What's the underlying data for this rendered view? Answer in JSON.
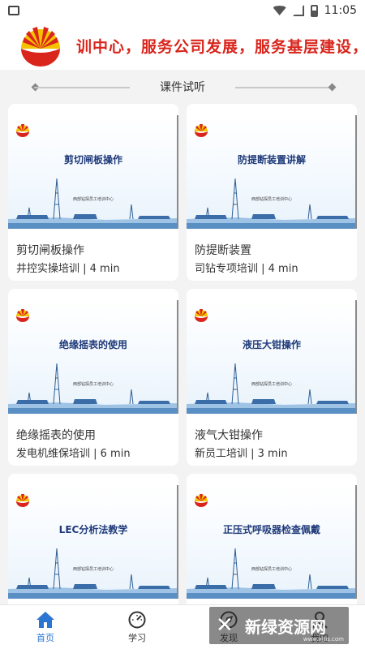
{
  "status_bar": {
    "time": "11:05"
  },
  "banner": {
    "marquee": "训中心，服务公司发展，服务基层建设，"
  },
  "section": {
    "title": "课件试听"
  },
  "courses": [
    {
      "thumb_title": "剪切闸板操作",
      "thumb_sub": "西部钻探员工培训中心",
      "name": "剪切闸板操作",
      "meta": "井控实操培训 | 4 min"
    },
    {
      "thumb_title": "防提断装置讲解",
      "thumb_sub": "西部钻探员工培训中心",
      "name": "防提断装置",
      "meta": "司钻专项培训 | 4 min"
    },
    {
      "thumb_title": "绝缘摇表的使用",
      "thumb_sub": "西部钻探员工培训中心",
      "name": "绝缘摇表的使用",
      "meta": "发电机维保培训 | 6 min"
    },
    {
      "thumb_title": "液压大钳操作",
      "thumb_sub": "西部钻探员工培训中心",
      "name": "液气大钳操作",
      "meta": "新员工培训 | 3 min"
    },
    {
      "thumb_title": "LEC分析法教学",
      "thumb_sub": "西部钻探员工培训中心",
      "name": "",
      "meta": ""
    },
    {
      "thumb_title": "正压式呼吸器检查佩戴",
      "thumb_sub": "西部钻探员工培训中心",
      "name": "",
      "meta": ""
    }
  ],
  "tabs": [
    {
      "label": "首页",
      "icon": "home-icon",
      "active": true
    },
    {
      "label": "学习",
      "icon": "gauge-icon",
      "active": false
    },
    {
      "label": "发现",
      "icon": "compass-icon",
      "active": false
    },
    {
      "label": "我的",
      "icon": "user-icon",
      "active": false
    }
  ],
  "watermark": {
    "text": "新绿资源网",
    "url": "www.xlhs.com"
  },
  "colors": {
    "accent": "#2a76d2",
    "brand_red": "#d9251c",
    "thumb_title": "#1f3a7a"
  }
}
